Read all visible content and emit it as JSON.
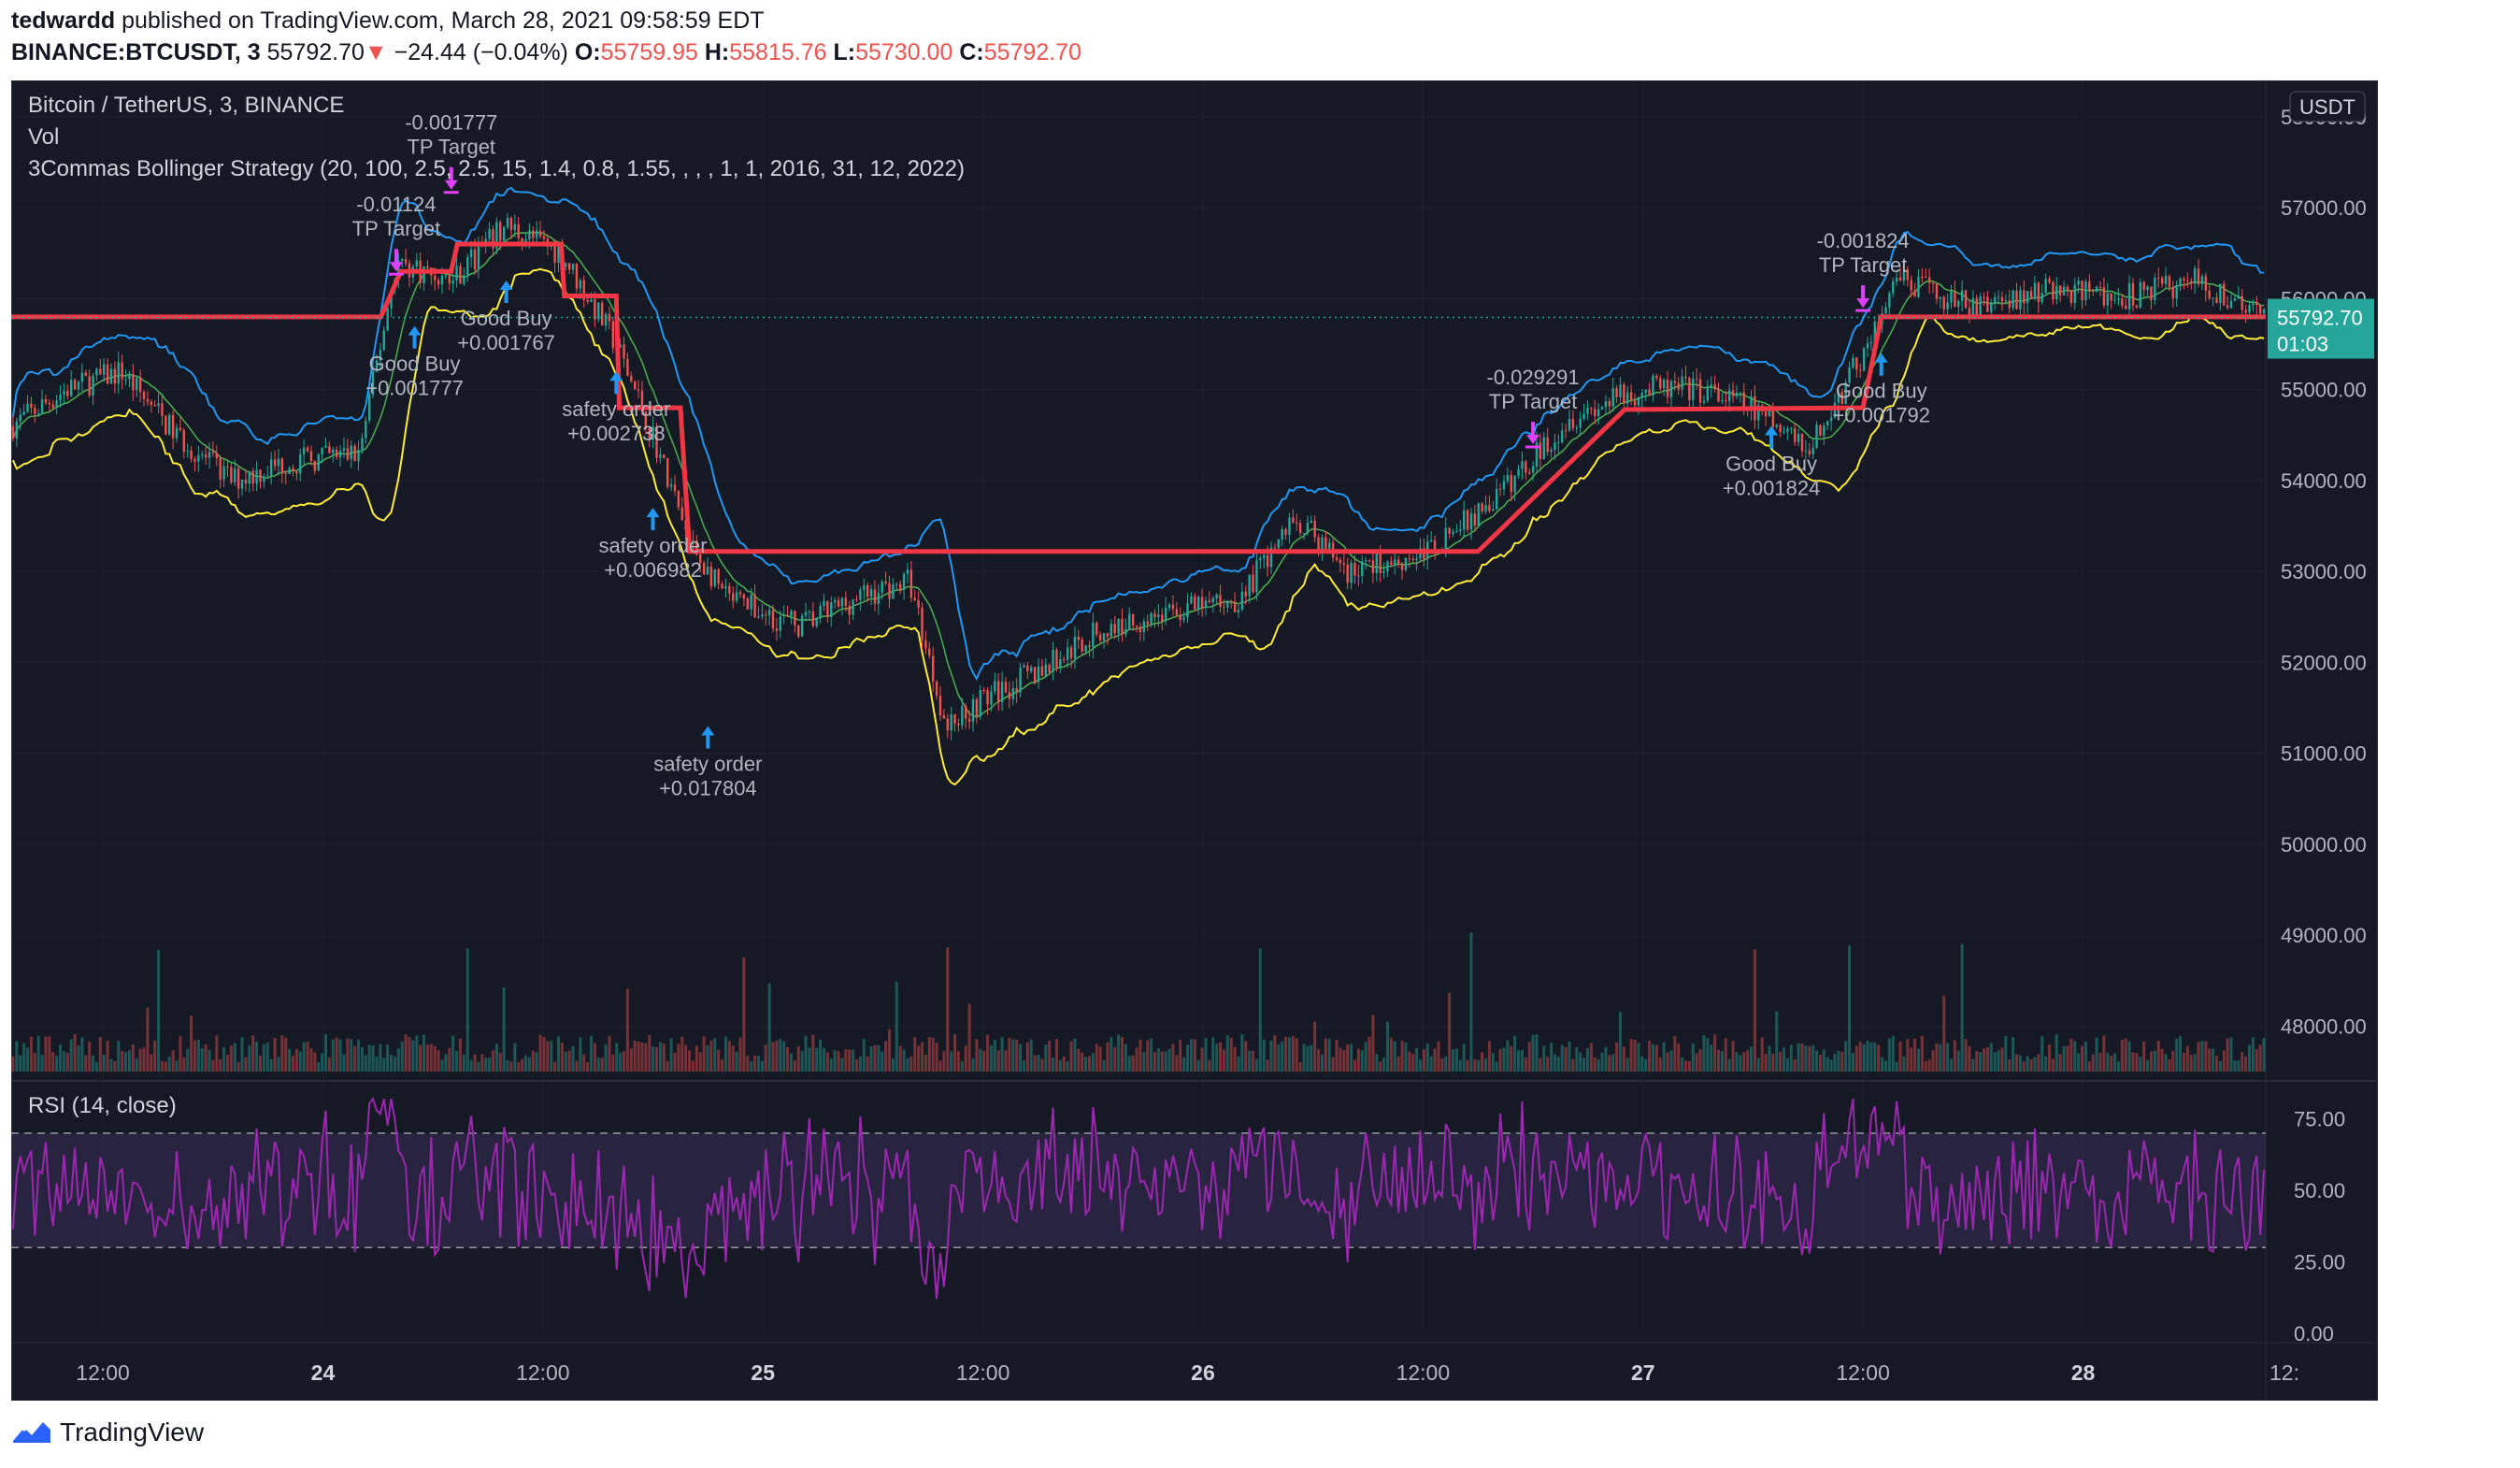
{
  "header": {
    "author": "tedwardd",
    "published_text": "published on TradingView.com, March 28, 2021 09:58:59 EDT",
    "symbol": "BINANCE:BTCUSDT, 3",
    "last": "55792.70",
    "change_arrow": "▼",
    "change": "−24.44 (−0.04%)",
    "o_label": "O:",
    "o": "55759.95",
    "h_label": "H:",
    "h": "55815.76",
    "l_label": "L:",
    "l": "55730.00",
    "c_label": "C:",
    "c": "55792.70"
  },
  "legend": {
    "series_title": "Bitcoin / TetherUS, 3, BINANCE",
    "vol": "Vol",
    "strategy": "3Commas Bollinger Strategy (20, 100, 2.5, 2.5, 15, 1.4, 0.8, 1.55, , , , 1, 1, 2016, 31, 12, 2022)",
    "rsi": "RSI (14, close)"
  },
  "price_axis": {
    "currency": "USDT",
    "ticks": [
      "58000.00",
      "57000.00",
      "56000.00",
      "55000.00",
      "54000.00",
      "53000.00",
      "52000.00",
      "51000.00",
      "50000.00",
      "49000.00",
      "48000.00"
    ],
    "last_price": "55792.70",
    "countdown": "01:03"
  },
  "rsi_axis": {
    "ticks": [
      "75.00",
      "50.00",
      "25.00",
      "0.00"
    ]
  },
  "time_axis": {
    "ticks": [
      "12:00",
      "24",
      "12:00",
      "25",
      "12:00",
      "26",
      "12:00",
      "27",
      "12:00",
      "28",
      "12:"
    ]
  },
  "footer": {
    "brand": "TradingView"
  },
  "colors": {
    "bg": "#151924",
    "up": "#26a69a",
    "down": "#ef5350",
    "upper_band": "#2196f3",
    "lower_band": "#ffeb3b",
    "basis": "#4caf50",
    "strategy_line": "#f23645",
    "rsi": "#9c27b0",
    "rsi_band": "#7e57c2",
    "buy_marker": "#2196f3",
    "sell_marker": "#e040fb"
  },
  "chart_data": {
    "type": "candlestick",
    "interval": "3m",
    "title": "Bitcoin / TetherUS, 3, BINANCE",
    "x_range": [
      "2021-03-23 07:00",
      "2021-03-28 09:58"
    ],
    "y_range": [
      47500,
      58400
    ],
    "close_path": [
      [
        "2021-03-23 07:00",
        54600
      ],
      [
        "2021-03-23 10:00",
        55000
      ],
      [
        "2021-03-23 13:00",
        55200
      ],
      [
        "2021-03-23 16:00",
        54500
      ],
      [
        "2021-03-23 19:00",
        54000
      ],
      [
        "2021-03-23 22:00",
        54200
      ],
      [
        "2021-03-24 02:00",
        54300
      ],
      [
        "2021-03-24 04:00",
        56400
      ],
      [
        "2021-03-24 07:00",
        56200
      ],
      [
        "2021-03-24 10:00",
        56800
      ],
      [
        "2021-03-24 13:00",
        56500
      ],
      [
        "2021-03-24 16:00",
        55500
      ],
      [
        "2021-03-24 18:00",
        54500
      ],
      [
        "2021-03-24 20:00",
        53300
      ],
      [
        "2021-03-24 22:00",
        52700
      ],
      [
        "2021-03-25 02:00",
        52400
      ],
      [
        "2021-03-25 05:00",
        52700
      ],
      [
        "2021-03-25 08:00",
        52900
      ],
      [
        "2021-03-25 10:00",
        51300
      ],
      [
        "2021-03-25 12:00",
        51600
      ],
      [
        "2021-03-25 15:00",
        51900
      ],
      [
        "2021-03-25 18:00",
        52300
      ],
      [
        "2021-03-25 21:00",
        52500
      ],
      [
        "2021-03-26 02:00",
        52700
      ],
      [
        "2021-03-26 05:00",
        53600
      ],
      [
        "2021-03-26 08:00",
        53000
      ],
      [
        "2021-03-26 12:00",
        53200
      ],
      [
        "2021-03-26 16:00",
        53800
      ],
      [
        "2021-03-26 20:00",
        54700
      ],
      [
        "2021-03-27 00:00",
        55000
      ],
      [
        "2021-03-27 03:00",
        55000
      ],
      [
        "2021-03-27 06:00",
        54800
      ],
      [
        "2021-03-27 09:00",
        54300
      ],
      [
        "2021-03-27 12:00",
        55400
      ],
      [
        "2021-03-27 14:00",
        56200
      ],
      [
        "2021-03-27 18:00",
        55900
      ],
      [
        "2021-03-27 22:00",
        56100
      ],
      [
        "2021-03-28 02:00",
        56000
      ],
      [
        "2021-03-28 06:00",
        56200
      ],
      [
        "2021-03-28 09:58",
        55792.7
      ]
    ],
    "strategy_level": [
      [
        "2021-03-23 07:00",
        55800
      ],
      [
        "2021-03-24 03:10",
        55800
      ],
      [
        "2021-03-24 04:15",
        56300
      ],
      [
        "2021-03-24 07:00",
        56300
      ],
      [
        "2021-03-24 07:20",
        56600
      ],
      [
        "2021-03-24 13:00",
        56600
      ],
      [
        "2021-03-24 13:10",
        56030
      ],
      [
        "2021-03-24 16:00",
        56030
      ],
      [
        "2021-03-24 16:10",
        54800
      ],
      [
        "2021-03-24 19:30",
        54800
      ],
      [
        "2021-03-24 20:00",
        53220
      ],
      [
        "2021-03-26 15:00",
        53220
      ],
      [
        "2021-03-26 23:00",
        54780
      ],
      [
        "2021-03-27 12:00",
        54800
      ],
      [
        "2021-03-27 13:00",
        55800
      ],
      [
        "2021-03-28 09:58",
        55800
      ]
    ],
    "rsi": {
      "upper": 70,
      "lower": 30,
      "range": [
        0,
        85
      ]
    },
    "annotations": [
      {
        "type": "sell",
        "label": "TP Target",
        "value": "-0.01124",
        "time": "2021-03-24 04:00",
        "price": 56300
      },
      {
        "type": "sell",
        "label": "TP Target",
        "value": "-0.001777",
        "time": "2021-03-24 07:00",
        "price": 57200
      },
      {
        "type": "buy",
        "label": "Good Buy",
        "value": "+0.001777",
        "time": "2021-03-24 05:00",
        "price": 55700
      },
      {
        "type": "buy",
        "label": "Good Buy",
        "value": "+0.001767",
        "time": "2021-03-24 10:00",
        "price": 56200
      },
      {
        "type": "buy",
        "label": "safety order",
        "value": "+0.002738",
        "time": "2021-03-24 16:00",
        "price": 55200
      },
      {
        "type": "buy",
        "label": "safety order",
        "value": "+0.006982",
        "time": "2021-03-24 18:00",
        "price": 53700
      },
      {
        "type": "buy",
        "label": "safety order",
        "value": "+0.017804",
        "time": "2021-03-24 21:00",
        "price": 51300
      },
      {
        "type": "sell",
        "label": "TP Target",
        "value": "-0.029291",
        "time": "2021-03-26 18:00",
        "price": 54400
      },
      {
        "type": "buy",
        "label": "Good Buy",
        "value": "+0.001824",
        "time": "2021-03-27 07:00",
        "price": 54600
      },
      {
        "type": "sell",
        "label": "TP Target",
        "value": "-0.001824",
        "time": "2021-03-27 12:00",
        "price": 55900
      },
      {
        "type": "buy",
        "label": "Good Buy",
        "value": "+0.001792",
        "time": "2021-03-27 13:00",
        "price": 55400
      }
    ]
  }
}
